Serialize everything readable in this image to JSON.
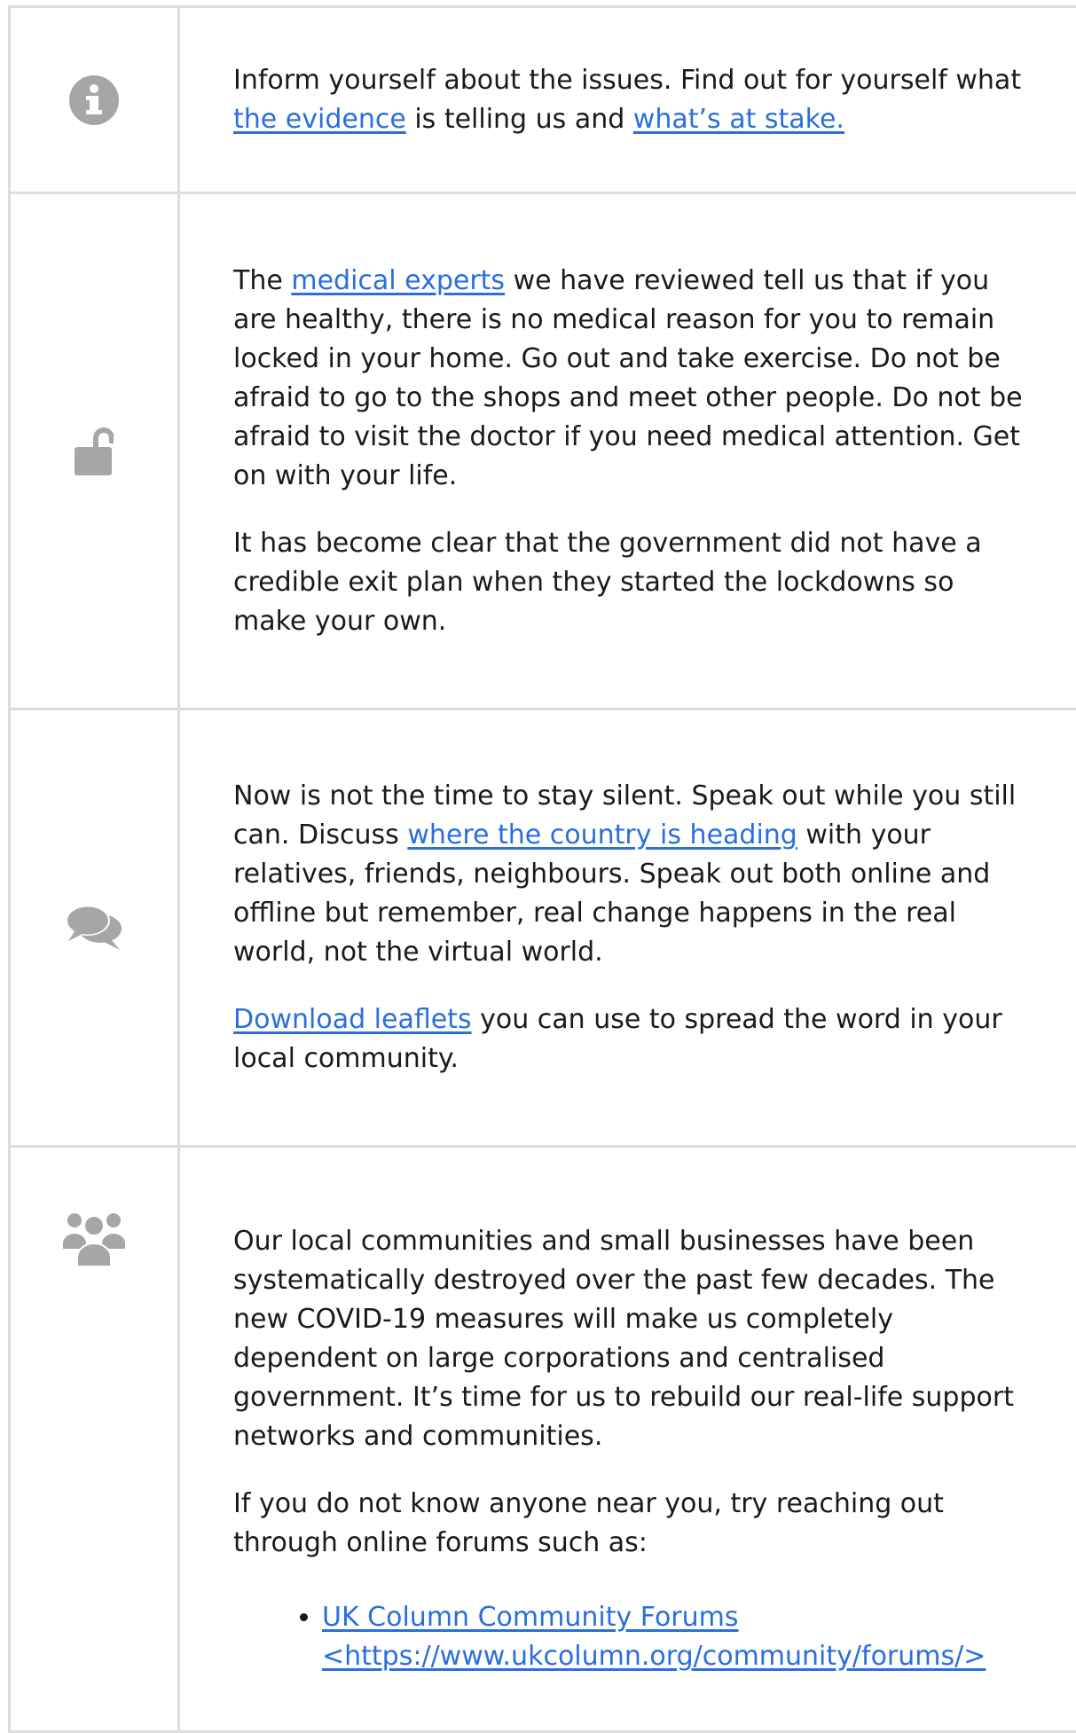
{
  "colors": {
    "link": "#2a6fdb",
    "icon": "#a6a6a6",
    "border": "#dcdcdc"
  },
  "rows": [
    {
      "icon": "info-circle-icon",
      "paragraphs": [
        {
          "t1": "Inform yourself about the issues. Find out for yourself what ",
          "link1": "the evidence",
          "t2": " is telling us and ",
          "link2": "what’s at stake."
        }
      ]
    },
    {
      "icon": "unlock-icon",
      "p1": {
        "t1": "The ",
        "link1": "medical experts",
        "t2": " we have reviewed tell us that if you are healthy, there is no medical reason for you to remain locked in your home. Go out and take exercise. Do not be afraid to go to the shops and meet other people. Do not be afraid to visit the doctor if you need medical attention. Get on with your life."
      },
      "p2": "It has become clear that the government did not have a credible exit plan when they started the lockdowns so make your own."
    },
    {
      "icon": "comments-icon",
      "p1": {
        "t1": "Now is not the time to stay silent. Speak out while you still can. Discuss ",
        "link1": "where the country is heading",
        "t2": " with your relatives, friends, neighbours. Speak out both online and offline but remember, real change happens in the real world, not the virtual world."
      },
      "p2": {
        "link1": "Download leaflets",
        "t1": " you can use to spread the word in your local community."
      }
    },
    {
      "icon": "users-icon",
      "p1": "Our local communities and small businesses have been systematically destroyed over the past few decades. The new COVID-19 measures will make us completely dependent on large corporations and centralised government. It’s time for us to rebuild our real-life support networks and communities.",
      "p2": "If you do not know anyone near you, try reaching out through online forums such as:",
      "list": [
        {
          "link": "UK Column Community Forums <https://www.ukcolumn.org/community/forums/>"
        }
      ]
    }
  ]
}
